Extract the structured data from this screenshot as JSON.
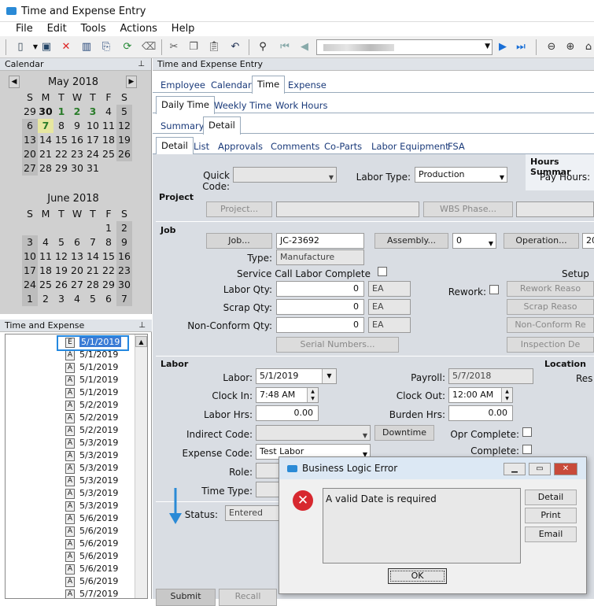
{
  "app": {
    "title": "Time and Expense Entry"
  },
  "menu": [
    "File",
    "Edit",
    "Tools",
    "Actions",
    "Help"
  ],
  "calendar_pane": {
    "title": "Calendar",
    "may": {
      "label": "May 2018",
      "weekdays": [
        "S",
        "M",
        "T",
        "W",
        "T",
        "F",
        "S"
      ],
      "days": [
        "29",
        "30",
        "1",
        "2",
        "3",
        "4",
        "5",
        "6",
        "7",
        "8",
        "9",
        "10",
        "11",
        "12",
        "13",
        "14",
        "15",
        "16",
        "17",
        "18",
        "19",
        "20",
        "21",
        "22",
        "23",
        "24",
        "25",
        "26",
        "27",
        "28",
        "29",
        "30",
        "31"
      ]
    },
    "june": {
      "label": "June 2018",
      "weekdays": [
        "S",
        "M",
        "T",
        "W",
        "T",
        "F",
        "S"
      ],
      "days": [
        "1",
        "2",
        "3",
        "4",
        "5",
        "6",
        "7",
        "8",
        "9",
        "10",
        "11",
        "12",
        "13",
        "14",
        "15",
        "16",
        "17",
        "18",
        "19",
        "20",
        "21",
        "22",
        "23",
        "24",
        "25",
        "26",
        "27",
        "28",
        "29",
        "30",
        "1",
        "2",
        "3",
        "4",
        "5",
        "6",
        "7"
      ]
    }
  },
  "te_pane": {
    "title": "Time and Expense",
    "entries": [
      {
        "icon": "E",
        "date": "5/1/2019"
      },
      {
        "icon": "A",
        "date": "5/1/2019"
      },
      {
        "icon": "A",
        "date": "5/1/2019"
      },
      {
        "icon": "A",
        "date": "5/1/2019"
      },
      {
        "icon": "A",
        "date": "5/1/2019"
      },
      {
        "icon": "A",
        "date": "5/2/2019"
      },
      {
        "icon": "A",
        "date": "5/2/2019"
      },
      {
        "icon": "A",
        "date": "5/2/2019"
      },
      {
        "icon": "A",
        "date": "5/3/2019"
      },
      {
        "icon": "A",
        "date": "5/3/2019"
      },
      {
        "icon": "A",
        "date": "5/3/2019"
      },
      {
        "icon": "A",
        "date": "5/3/2019"
      },
      {
        "icon": "A",
        "date": "5/3/2019"
      },
      {
        "icon": "A",
        "date": "5/3/2019"
      },
      {
        "icon": "A",
        "date": "5/6/2019"
      },
      {
        "icon": "A",
        "date": "5/6/2019"
      },
      {
        "icon": "A",
        "date": "5/6/2019"
      },
      {
        "icon": "A",
        "date": "5/6/2019"
      },
      {
        "icon": "A",
        "date": "5/6/2019"
      },
      {
        "icon": "A",
        "date": "5/6/2019"
      },
      {
        "icon": "A",
        "date": "5/7/2019"
      },
      {
        "icon": "A",
        "date": "5/7/2019"
      }
    ]
  },
  "main": {
    "header": "Time and Expense Entry",
    "tabs1": [
      "Employee",
      "Calendar",
      "Time",
      "Expense"
    ],
    "tabs2": [
      "Daily Time",
      "Weekly Time",
      "Work Hours"
    ],
    "tabs3": [
      "Summary",
      "Detail"
    ],
    "tabs4": [
      "Detail",
      "List",
      "Approvals",
      "Comments",
      "Co-Parts",
      "Labor Equipment",
      "FSA"
    ],
    "quick_code_label": "Quick Code:",
    "labor_type_label": "Labor Type:",
    "labor_type_value": "Production",
    "hours_summary_label": "Hours Summar",
    "pay_hours_label": "Pay Hours:",
    "project_section": "Project",
    "project_btn": "Project...",
    "wbs_btn": "WBS Phase...",
    "job_section": "Job",
    "job_btn": "Job...",
    "job_value": "JC-23692",
    "assembly_btn": "Assembly...",
    "assembly_value": "0",
    "operation_btn": "Operation...",
    "operation_value": "20",
    "type_label": "Type:",
    "type_value": "Manufacture",
    "service_call_label": "Service Call Labor Complete",
    "setup_label": "Setup",
    "labor_qty_label": "Labor Qty:",
    "labor_qty_value": "0",
    "scrap_qty_label": "Scrap Qty:",
    "scrap_qty_value": "0",
    "nonconform_qty_label": "Non-Conform Qty:",
    "nonconform_qty_value": "0",
    "uom": "EA",
    "rework_label": "Rework:",
    "rework_reason_btn": "Rework Reaso",
    "scrap_reason_btn": "Scrap Reaso",
    "nonconform_reason_btn": "Non-Conform Re",
    "inspection_btn": "Inspection De",
    "serial_btn": "Serial Numbers...",
    "labor_section": "Labor",
    "labor_label": "Labor:",
    "labor_date": "5/1/2019",
    "payroll_label": "Payroll:",
    "payroll_date": "5/7/2018",
    "location_section": "Location",
    "res_label": "Res",
    "clock_in_label": "Clock In:",
    "clock_in_value": "7:48 AM",
    "clock_out_label": "Clock Out:",
    "clock_out_value": "12:00 AM",
    "labor_hrs_label": "Labor Hrs:",
    "labor_hrs_value": "0.00",
    "burden_hrs_label": "Burden Hrs:",
    "burden_hrs_value": "0.00",
    "indirect_code_label": "Indirect Code:",
    "downtime_btn": "Downtime",
    "opr_complete_label": "Opr Complete:",
    "expense_code_label": "Expense Code:",
    "expense_code_value": "Test Labor",
    "complete_label": "Complete:",
    "role_label": "Role:",
    "time_type_label": "Time Type:",
    "status_label": "Status:",
    "status_value": "Entered",
    "submit_btn": "Submit",
    "recall_btn": "Recall"
  },
  "dialog": {
    "title": "Business Logic Error",
    "message": "A valid Date is required",
    "detail_btn": "Detail",
    "print_btn": "Print",
    "email_btn": "Email",
    "ok_btn": "OK"
  }
}
